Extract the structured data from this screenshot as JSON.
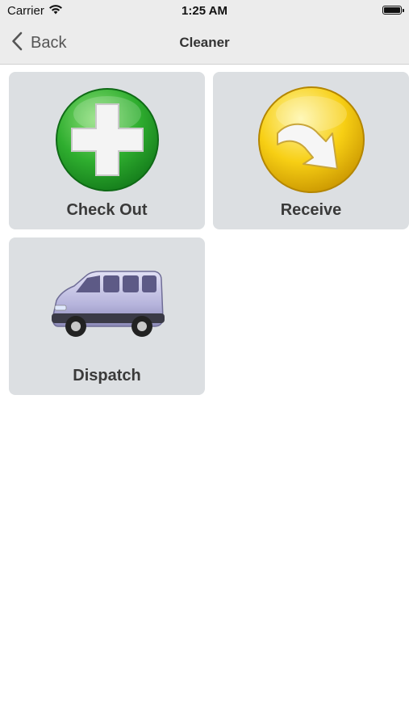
{
  "status_bar": {
    "carrier": "Carrier",
    "time": "1:25 AM",
    "icons": [
      "wifi-icon",
      "battery-icon"
    ]
  },
  "nav": {
    "back_label": "Back",
    "title": "Cleaner"
  },
  "tiles": [
    {
      "label": "Check Out",
      "icon": "green-plus-icon",
      "color": "#2eaa2e"
    },
    {
      "label": "Receive",
      "icon": "yellow-arrow-icon",
      "color": "#f1c40f"
    },
    {
      "label": "Dispatch",
      "icon": "van-icon",
      "color": "#b9b8dc"
    }
  ],
  "colors": {
    "bar_background": "#ececec",
    "tile_background": "#dcdfe2",
    "label_text": "#3a3a3a"
  }
}
